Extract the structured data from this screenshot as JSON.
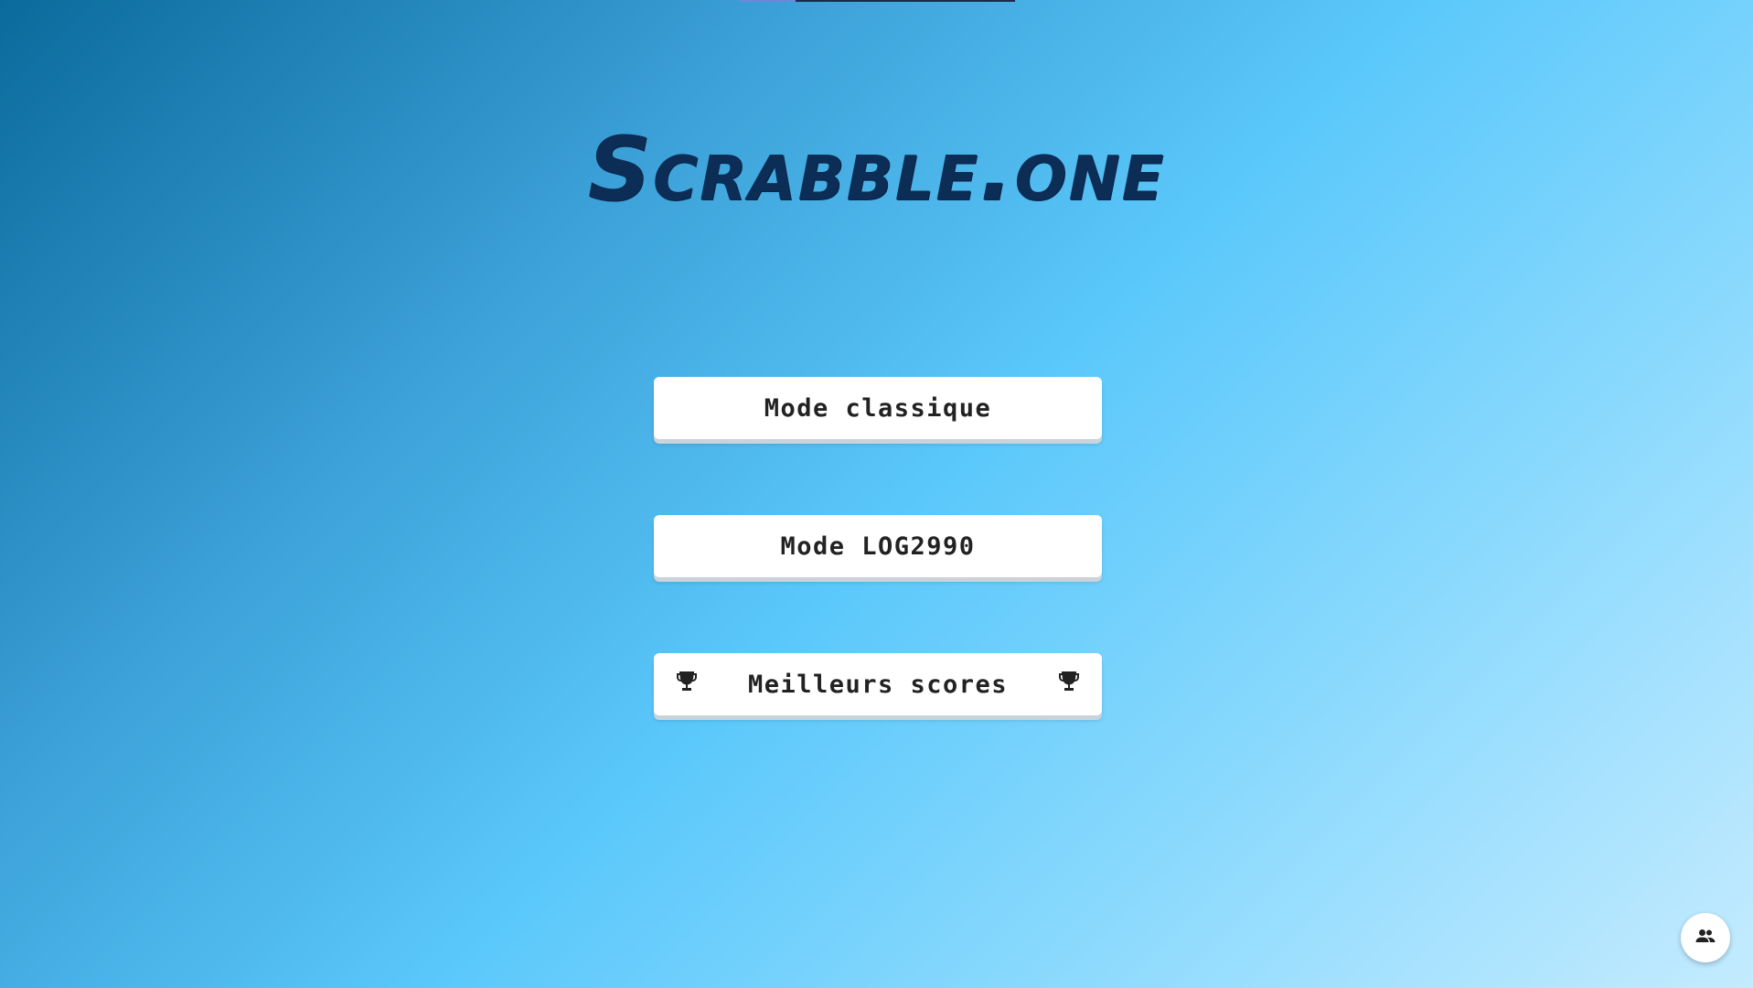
{
  "app": {
    "title": "Scrabble.one"
  },
  "menu": {
    "classic_label": "Mode classique",
    "log2990_label": "Mode LOG2990",
    "scores_label": "Meilleurs scores",
    "scores_icon": "trophy-icon"
  },
  "fab": {
    "icon": "people-icon"
  },
  "colors": {
    "title": "#0c2d55",
    "button_bg": "#ffffff",
    "button_text": "#222222",
    "gradient_start": "#0a6a9c",
    "gradient_end": "#c4ebff"
  }
}
